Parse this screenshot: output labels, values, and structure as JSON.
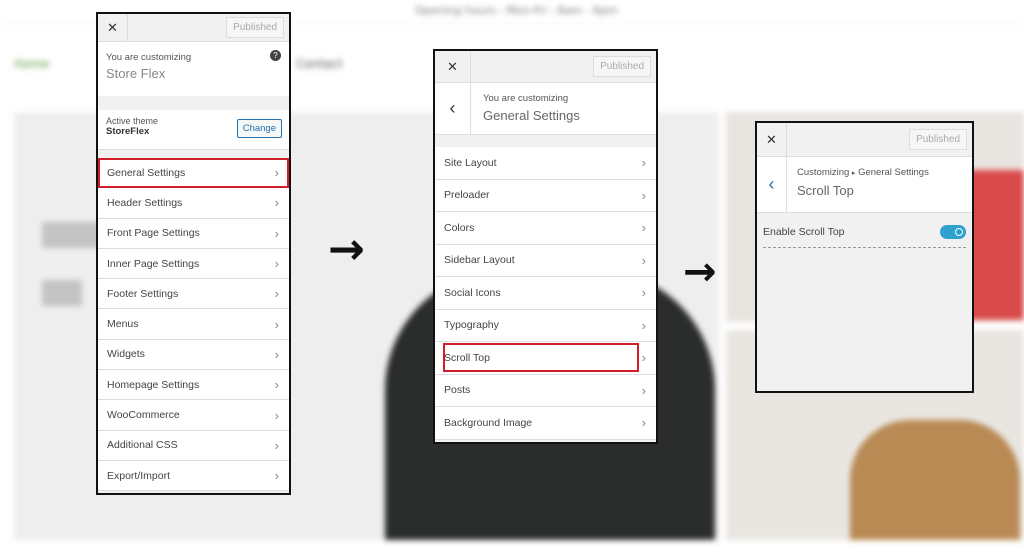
{
  "background": {
    "top_text": "Opening hours : Mon-Fri : 8am - 6pm",
    "nav": [
      "Home",
      "Contact"
    ]
  },
  "panel1": {
    "close": "✕",
    "published": "Published",
    "customizing_label": "You are customizing",
    "site_name": "Store Flex",
    "help_icon": "question-circle",
    "active_theme_label": "Active theme",
    "active_theme": "StoreFlex",
    "change": "Change",
    "items": [
      "General Settings",
      "Header Settings",
      "Front Page Settings",
      "Inner Page Settings",
      "Footer Settings",
      "Menus",
      "Widgets",
      "Homepage Settings",
      "WooCommerce",
      "Additional CSS",
      "Export/Import"
    ],
    "highlighted": "General Settings"
  },
  "panel2": {
    "close": "✕",
    "published": "Published",
    "back": "‹",
    "customizing_label": "You are customizing",
    "section": "General Settings",
    "items": [
      "Site Layout",
      "Preloader",
      "Colors",
      "Sidebar Layout",
      "Social Icons",
      "Typography",
      "Scroll Top",
      "Posts",
      "Background Image"
    ],
    "highlighted": "Scroll Top"
  },
  "panel3": {
    "close": "✕",
    "published": "Published",
    "back": "‹",
    "breadcrumb_root": "Customizing",
    "breadcrumb_sep": "▸",
    "breadcrumb_parent": "General Settings",
    "section": "Scroll Top",
    "toggle_label": "Enable Scroll Top",
    "toggle_on": true
  },
  "arrows": [
    "→",
    "→"
  ],
  "colors": {
    "highlight": "#d21e2b",
    "toggle": "#2ea2cc"
  }
}
